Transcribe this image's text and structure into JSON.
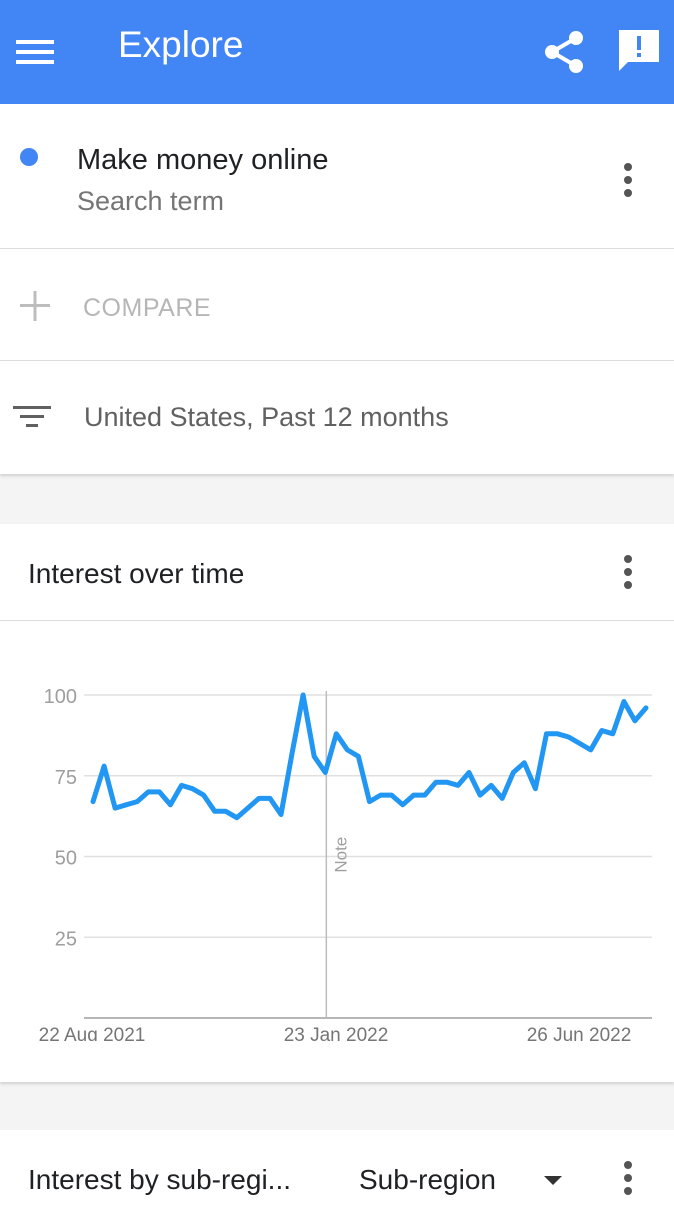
{
  "appbar": {
    "title": "Explore",
    "color": "#4285f4",
    "icons": [
      "menu-icon",
      "share-icon",
      "feedback-icon"
    ]
  },
  "search_term": {
    "name": "Make money online",
    "type": "Search term",
    "dot_color": "#4285f4"
  },
  "compare": {
    "label": "COMPARE"
  },
  "filters": {
    "label": "United States, Past 12 months"
  },
  "interest_over_time": {
    "title": "Interest over time",
    "note_label": "Note"
  },
  "chart_data": {
    "type": "line",
    "x_tick_labels": [
      "22 Aug 2021",
      "23 Jan 2022",
      "26 Jun 2022"
    ],
    "y_tick_labels": [
      "100",
      "75",
      "50",
      "25"
    ],
    "ylim": [
      0,
      100
    ],
    "grid": true,
    "annotation_week_index": 22,
    "series": [
      {
        "color": "#2196f3",
        "values": [
          67,
          78,
          65,
          66,
          67,
          70,
          70,
          66,
          72,
          71,
          69,
          64,
          64,
          62,
          65,
          68,
          68,
          63,
          82,
          100,
          81,
          76,
          88,
          83,
          81,
          67,
          69,
          69,
          66,
          69,
          69,
          73,
          73,
          72,
          76,
          69,
          72,
          68,
          76,
          79,
          71,
          88,
          88,
          87,
          85,
          83,
          89,
          88,
          98,
          92,
          96
        ]
      }
    ]
  },
  "sub_region": {
    "title": "Interest by sub-regi...",
    "select_value": "Sub-region"
  }
}
